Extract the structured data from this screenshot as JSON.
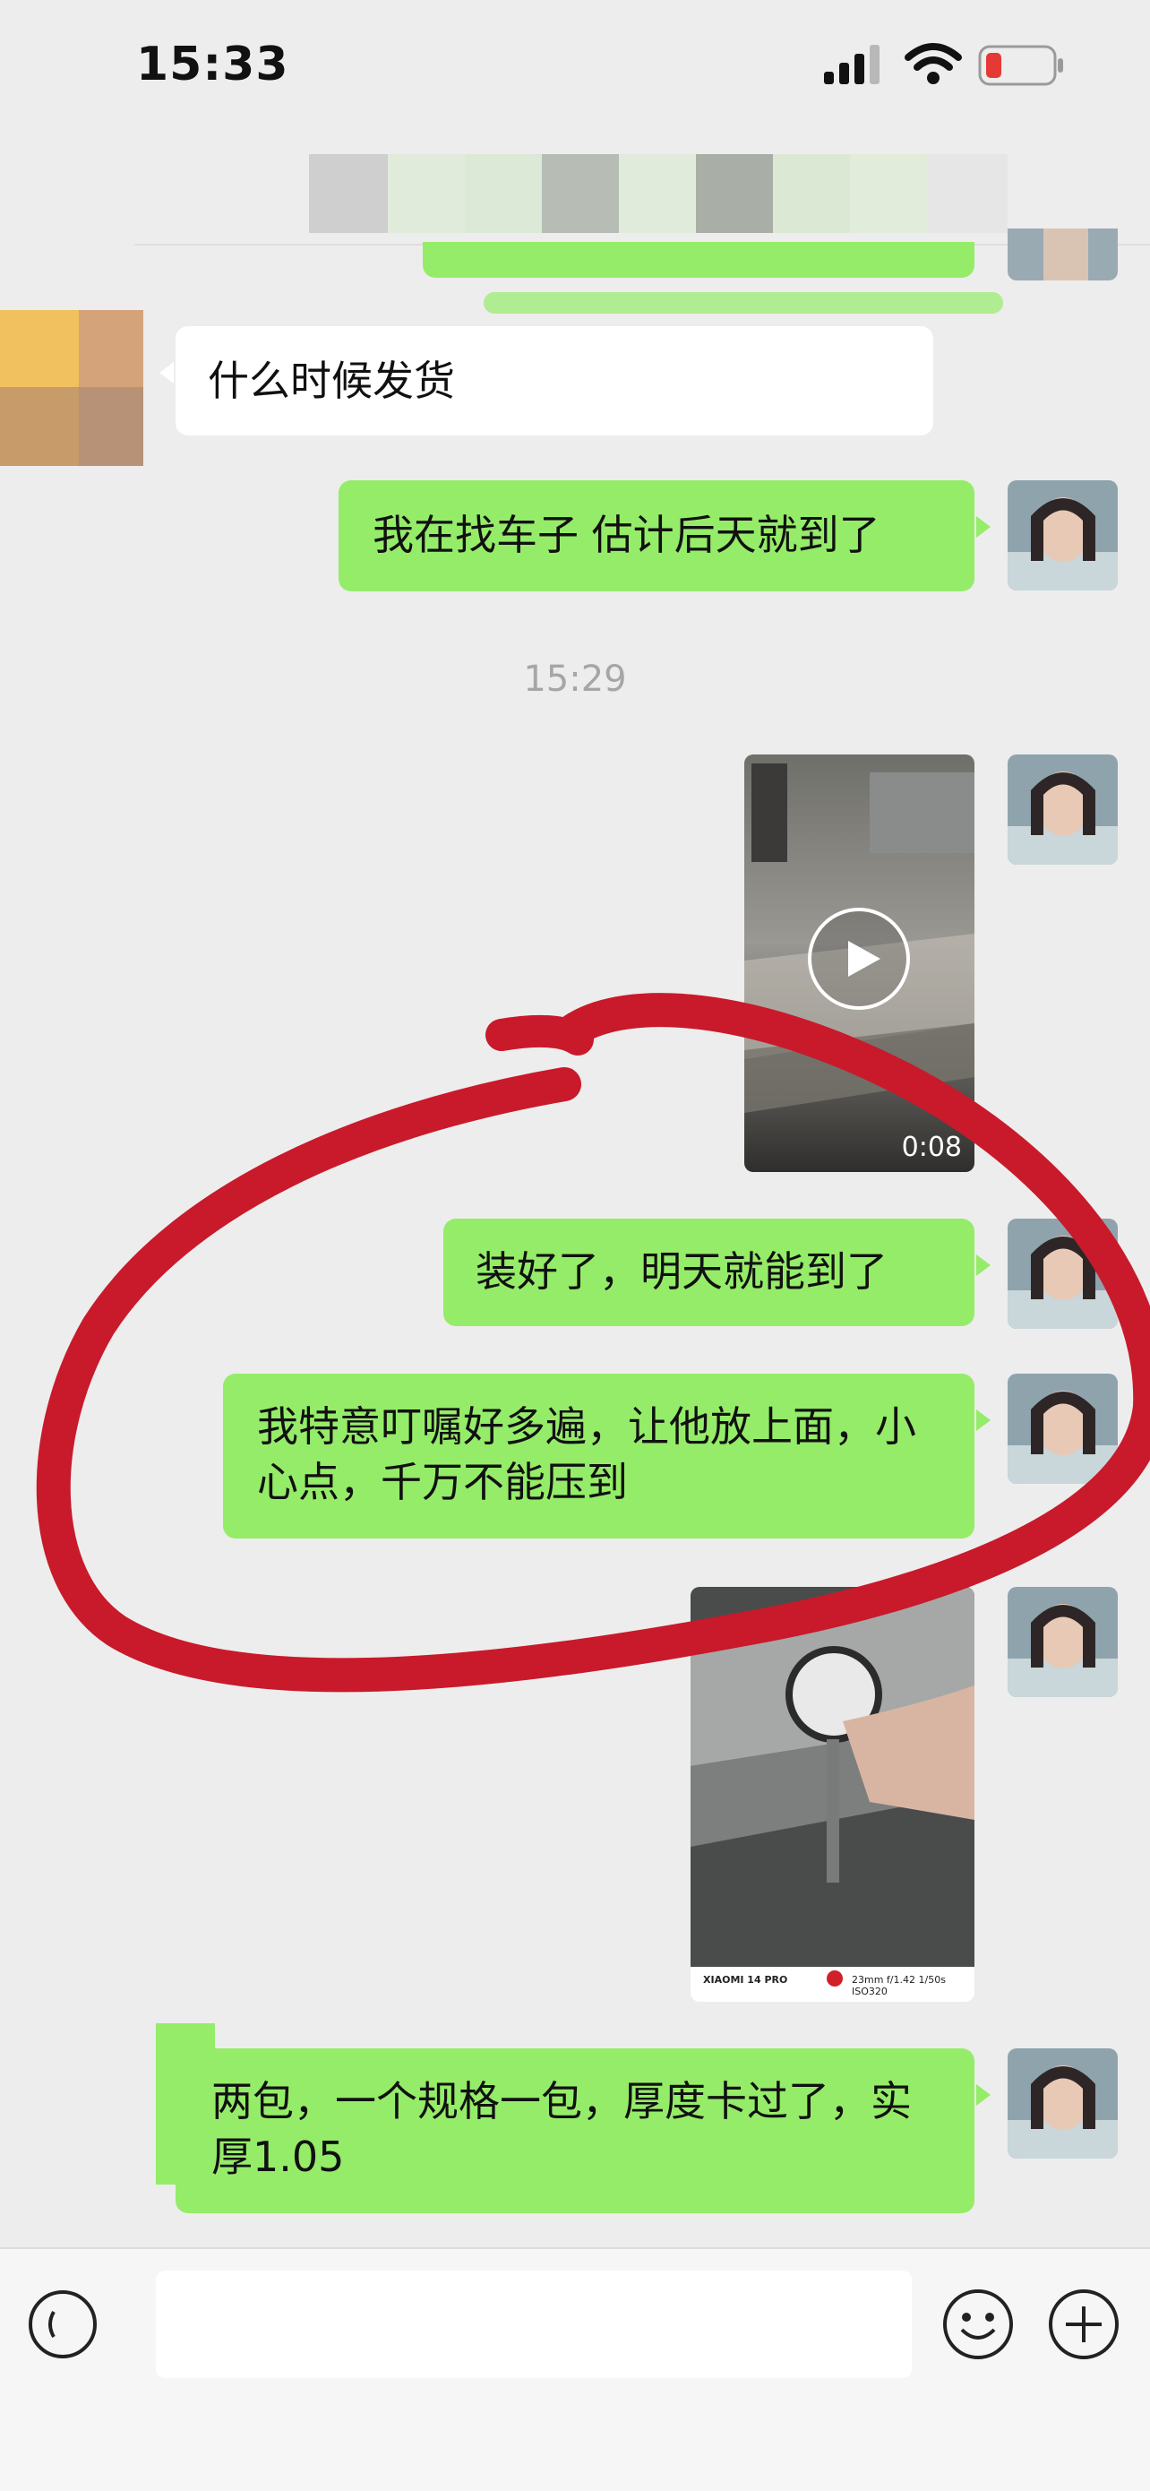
{
  "status_bar": {
    "time": "15:33"
  },
  "messages": {
    "received_1": "什么时候发货",
    "sent_1": "我在找车子 估计后天就到了",
    "timestamp": "15:29",
    "video_duration": "0:08",
    "sent_2": "装好了，明天就能到了",
    "sent_3": "我特意叮嘱好多遍，让他放上面，小心点，千万不能压到",
    "photo_caption_left": "XIAOMI 14 PRO",
    "photo_caption_right": "23mm f/1.42 1/50s ISO320",
    "sent_4": "两包，一个规格一包，厚度卡过了，实厚1.05"
  },
  "colors": {
    "sent_bubble": "#95ec69",
    "received_bubble": "#ffffff",
    "background": "#ededed",
    "annotation_stroke": "#c81a2b"
  },
  "icons": {
    "signal": "signal-icon",
    "wifi": "wifi-icon",
    "battery": "battery-low-icon",
    "voice": "voice-icon",
    "emoji": "emoji-icon",
    "add": "add-icon",
    "play": "play-icon"
  }
}
